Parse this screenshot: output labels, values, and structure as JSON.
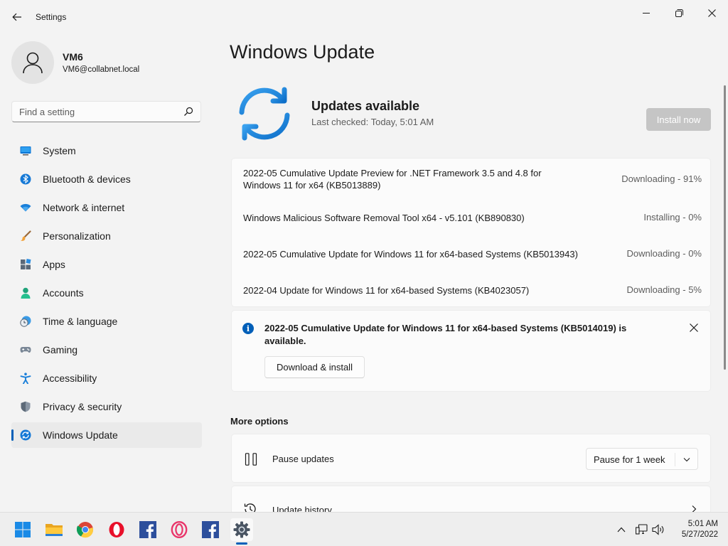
{
  "window": {
    "title": "Settings"
  },
  "user": {
    "name": "VM6",
    "email": "VM6@collabnet.local"
  },
  "search": {
    "placeholder": "Find a setting"
  },
  "sidebar": {
    "items": [
      {
        "label": "System",
        "icon": "system-icon"
      },
      {
        "label": "Bluetooth & devices",
        "icon": "bluetooth-icon"
      },
      {
        "label": "Network & internet",
        "icon": "wifi-icon"
      },
      {
        "label": "Personalization",
        "icon": "brush-icon"
      },
      {
        "label": "Apps",
        "icon": "apps-icon"
      },
      {
        "label": "Accounts",
        "icon": "accounts-icon"
      },
      {
        "label": "Time & language",
        "icon": "clock-globe-icon"
      },
      {
        "label": "Gaming",
        "icon": "gamepad-icon"
      },
      {
        "label": "Accessibility",
        "icon": "accessibility-icon"
      },
      {
        "label": "Privacy & security",
        "icon": "shield-icon"
      },
      {
        "label": "Windows Update",
        "icon": "windows-update-icon",
        "active": true
      }
    ]
  },
  "main": {
    "title": "Windows Update",
    "status": {
      "title": "Updates available",
      "last_checked": "Last checked: Today, 5:01 AM",
      "install_button": "Install now"
    },
    "updates": [
      {
        "name": "2022-05 Cumulative Update Preview for .NET Framework 3.5 and 4.8 for Windows 11 for x64 (KB5013889)",
        "status": "Downloading - 91%"
      },
      {
        "name": "Windows Malicious Software Removal Tool x64 - v5.101 (KB890830)",
        "status": "Installing - 0%"
      },
      {
        "name": "2022-05 Cumulative Update for Windows 11 for x64-based Systems (KB5013943)",
        "status": "Downloading - 0%"
      },
      {
        "name": "2022-04 Update for Windows 11 for x64-based Systems (KB4023057)",
        "status": "Downloading - 5%"
      }
    ],
    "optional_update": {
      "text": "2022-05 Cumulative Update for Windows 11 for x64-based Systems (KB5014019) is available.",
      "button": "Download & install"
    },
    "more_options": {
      "title": "More options",
      "pause": {
        "label": "Pause updates",
        "selected": "Pause for 1 week"
      },
      "history": {
        "label": "Update history"
      }
    }
  },
  "taskbar": {
    "apps": [
      "start-icon",
      "file-explorer-icon",
      "chrome-icon",
      "opera-icon",
      "facebook-icon",
      "opera-gx-icon",
      "facebook-icon",
      "settings-icon"
    ],
    "clock": {
      "time": "5:01 AM",
      "date": "5/27/2022"
    }
  },
  "colors": {
    "accent": "#005fb8",
    "sync_blue": "#1a86d9",
    "install_disabled": "#c5c5c5"
  }
}
